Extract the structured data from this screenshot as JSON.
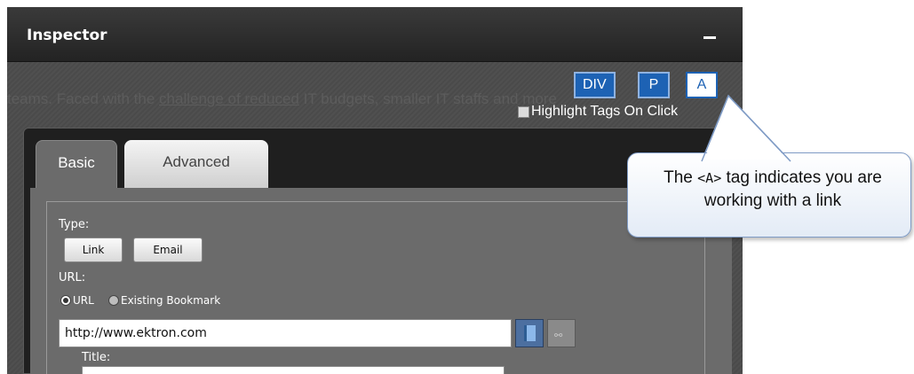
{
  "inspector": {
    "title": "Inspector",
    "minimize_symbol": "–"
  },
  "background_text": {
    "line1_before": "teams. Faced with the ",
    "line1_link": "challenge of reduced",
    "line1_after": " IT budgets, smaller IT staffs and more"
  },
  "tag_buttons": [
    {
      "label": "DIV",
      "active": false
    },
    {
      "label": "P",
      "active": false
    },
    {
      "label": "A",
      "active": true
    }
  ],
  "highlight_tags": {
    "label": "Highlight Tags On Click",
    "checked": false
  },
  "tabs": [
    {
      "label": "Basic",
      "selected": true
    },
    {
      "label": "Advanced",
      "selected": false
    }
  ],
  "form": {
    "type_label": "Type:",
    "type_buttons": [
      "Link",
      "Email"
    ],
    "url_label": "URL:",
    "radio_url": "URL",
    "radio_bookmark": "Existing Bookmark",
    "url_value": "http://www.ektron.com",
    "title_label": "Title:"
  },
  "callout": {
    "text_before": "The ",
    "tag": "<A>",
    "text_after": " tag indicates you are working with a link"
  },
  "colors": {
    "tag_blue": "#1d62b4",
    "titlebar": "#2b2b2b",
    "panel_gray": "#6b6b6b",
    "callout_border": "#7f9bc5"
  }
}
